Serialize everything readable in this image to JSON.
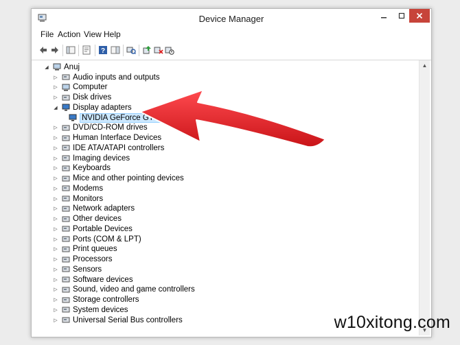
{
  "window": {
    "title": "Device Manager"
  },
  "menu": {
    "file": "File",
    "action": "Action",
    "view": "View",
    "help": "Help"
  },
  "tree": {
    "root": "Anuj",
    "categories": [
      {
        "label": "Audio inputs and outputs",
        "icon": "speaker-icon"
      },
      {
        "label": "Computer",
        "icon": "computer-icon"
      },
      {
        "label": "Disk drives",
        "icon": "disk-icon"
      },
      {
        "label": "Display adapters",
        "icon": "display-icon",
        "expanded": true
      },
      {
        "label": "DVD/CD-ROM drives",
        "icon": "dvd-icon"
      },
      {
        "label": "Human Interface Devices",
        "icon": "hid-icon"
      },
      {
        "label": "IDE ATA/ATAPI controllers",
        "icon": "ide-icon"
      },
      {
        "label": "Imaging devices",
        "icon": "camera-icon"
      },
      {
        "label": "Keyboards",
        "icon": "keyboard-icon"
      },
      {
        "label": "Mice and other pointing devices",
        "icon": "mouse-icon"
      },
      {
        "label": "Modems",
        "icon": "modem-icon"
      },
      {
        "label": "Monitors",
        "icon": "monitor-icon"
      },
      {
        "label": "Network adapters",
        "icon": "network-icon"
      },
      {
        "label": "Other devices",
        "icon": "unknown-device-icon"
      },
      {
        "label": "Portable Devices",
        "icon": "portable-icon"
      },
      {
        "label": "Ports (COM & LPT)",
        "icon": "port-icon"
      },
      {
        "label": "Print queues",
        "icon": "printer-icon"
      },
      {
        "label": "Processors",
        "icon": "cpu-icon"
      },
      {
        "label": "Sensors",
        "icon": "sensor-icon"
      },
      {
        "label": "Software devices",
        "icon": "software-icon"
      },
      {
        "label": "Sound, video and game controllers",
        "icon": "sound-icon"
      },
      {
        "label": "Storage controllers",
        "icon": "storage-icon"
      },
      {
        "label": "System devices",
        "icon": "system-icon"
      },
      {
        "label": "Universal Serial Bus controllers",
        "icon": "usb-icon"
      }
    ],
    "selected_child": "NVIDIA GeForce GT 610"
  },
  "colors": {
    "selection_bg": "#cce8ff",
    "arrow_red": "#e8262b",
    "close_button": "#c7443a"
  },
  "watermark": "w10xitong.com"
}
